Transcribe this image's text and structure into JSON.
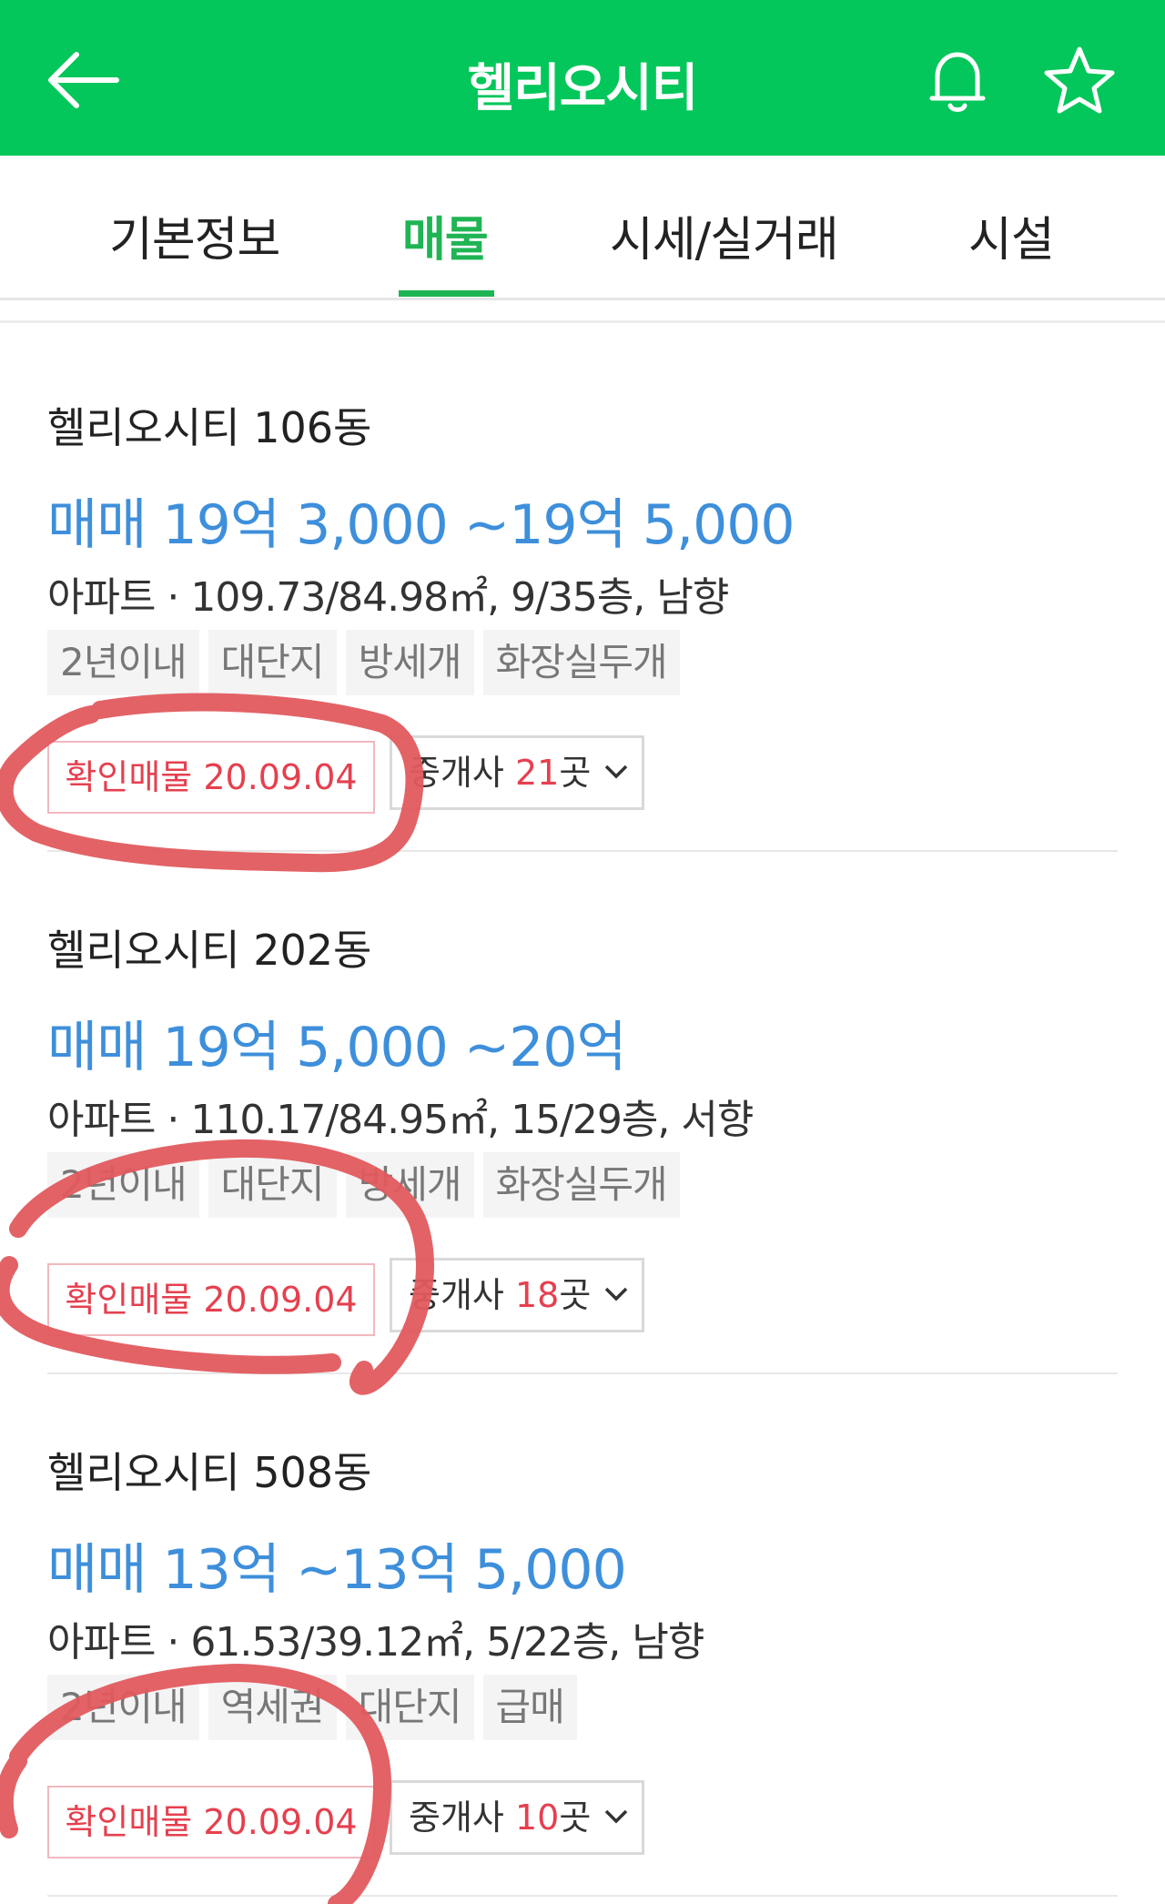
{
  "header": {
    "title": "헬리오시티",
    "back_icon": "arrow-left-icon",
    "notify_icon": "bell-icon",
    "favorite_icon": "star-icon",
    "background_color": "#03c75a"
  },
  "tabs": [
    {
      "label": "기본정보",
      "active": false
    },
    {
      "label": "매물",
      "active": true
    },
    {
      "label": "시세/실거래",
      "active": false
    },
    {
      "label": "시설",
      "active": false
    }
  ],
  "listings": [
    {
      "name": "헬리오시티 106동",
      "price": "매매 19억 3,000 ~19억 5,000",
      "detail": "아파트 · 109.73/84.98㎡, 9/35층, 남향",
      "tags": [
        "2년이내",
        "대단지",
        "방세개",
        "화장실두개"
      ],
      "confirm": "확인매물 20.09.04",
      "broker_prefix": "중개사",
      "broker_count": "21",
      "broker_suffix": "곳"
    },
    {
      "name": "헬리오시티 202동",
      "price": "매매 19억 5,000 ~20억",
      "detail": "아파트 · 110.17/84.95㎡, 15/29층, 서향",
      "tags": [
        "2년이내",
        "대단지",
        "방세개",
        "화장실두개"
      ],
      "confirm": "확인매물 20.09.04",
      "broker_prefix": "중개사",
      "broker_count": "18",
      "broker_suffix": "곳"
    },
    {
      "name": "헬리오시티 508동",
      "price": "매매 13억 ~13억 5,000",
      "detail": "아파트 · 61.53/39.12㎡, 5/22층, 남향",
      "tags": [
        "2년이내",
        "역세권",
        "대단지",
        "급매"
      ],
      "confirm": "확인매물 20.09.04",
      "broker_prefix": "중개사",
      "broker_count": "10",
      "broker_suffix": "곳"
    }
  ],
  "colors": {
    "accent_green": "#1fb454",
    "price_blue": "#3e8fdb",
    "confirm_red": "#e5404f",
    "annotation_red": "#e25a5e"
  }
}
